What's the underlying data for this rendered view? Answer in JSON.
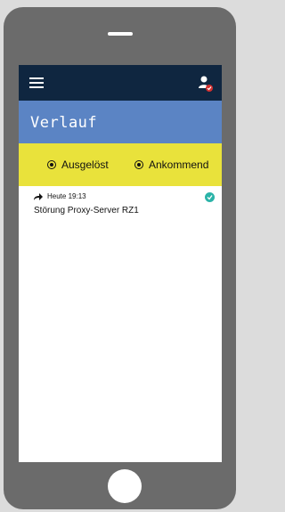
{
  "app": {
    "title": "Verlauf"
  },
  "filters": [
    {
      "label": "Ausgelöst",
      "selected": true
    },
    {
      "label": "Ankommend",
      "selected": true
    }
  ],
  "list": [
    {
      "time": "Heute 19:13",
      "title": "Störung Proxy-Server RZ1",
      "icon": "forward-arrow-icon",
      "status": "check-icon",
      "status_color": "#2bb3a8"
    }
  ],
  "colors": {
    "topbar": "#0f2640",
    "titlebar": "#5b84c4",
    "filterbar": "#e9e23b",
    "device": "#6b6b6b"
  }
}
